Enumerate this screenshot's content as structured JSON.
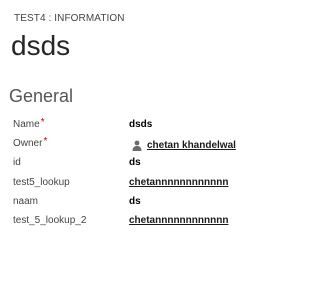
{
  "header": {
    "entity_type": "TEST4 : INFORMATION",
    "record_title": "dsds"
  },
  "section": {
    "title": "General"
  },
  "fields": [
    {
      "label": "Name",
      "required": true,
      "value": "dsds",
      "kind": "text"
    },
    {
      "label": "Owner",
      "required": true,
      "value": "chetan khandelwal",
      "kind": "owner",
      "icon": "user-icon"
    },
    {
      "label": "id",
      "required": false,
      "value": "ds",
      "kind": "text"
    },
    {
      "label": "test5_lookup",
      "required": false,
      "value": "chetannnnnnnnnnnn",
      "kind": "lookup"
    },
    {
      "label": "naam",
      "required": false,
      "value": "ds",
      "kind": "text"
    },
    {
      "label": "test_5_lookup_2",
      "required": false,
      "value": "chetannnnnnnnnnnn",
      "kind": "lookup"
    }
  ],
  "colors": {
    "required_marker": "#cc0000",
    "text": "#444444",
    "value": "#000000"
  }
}
